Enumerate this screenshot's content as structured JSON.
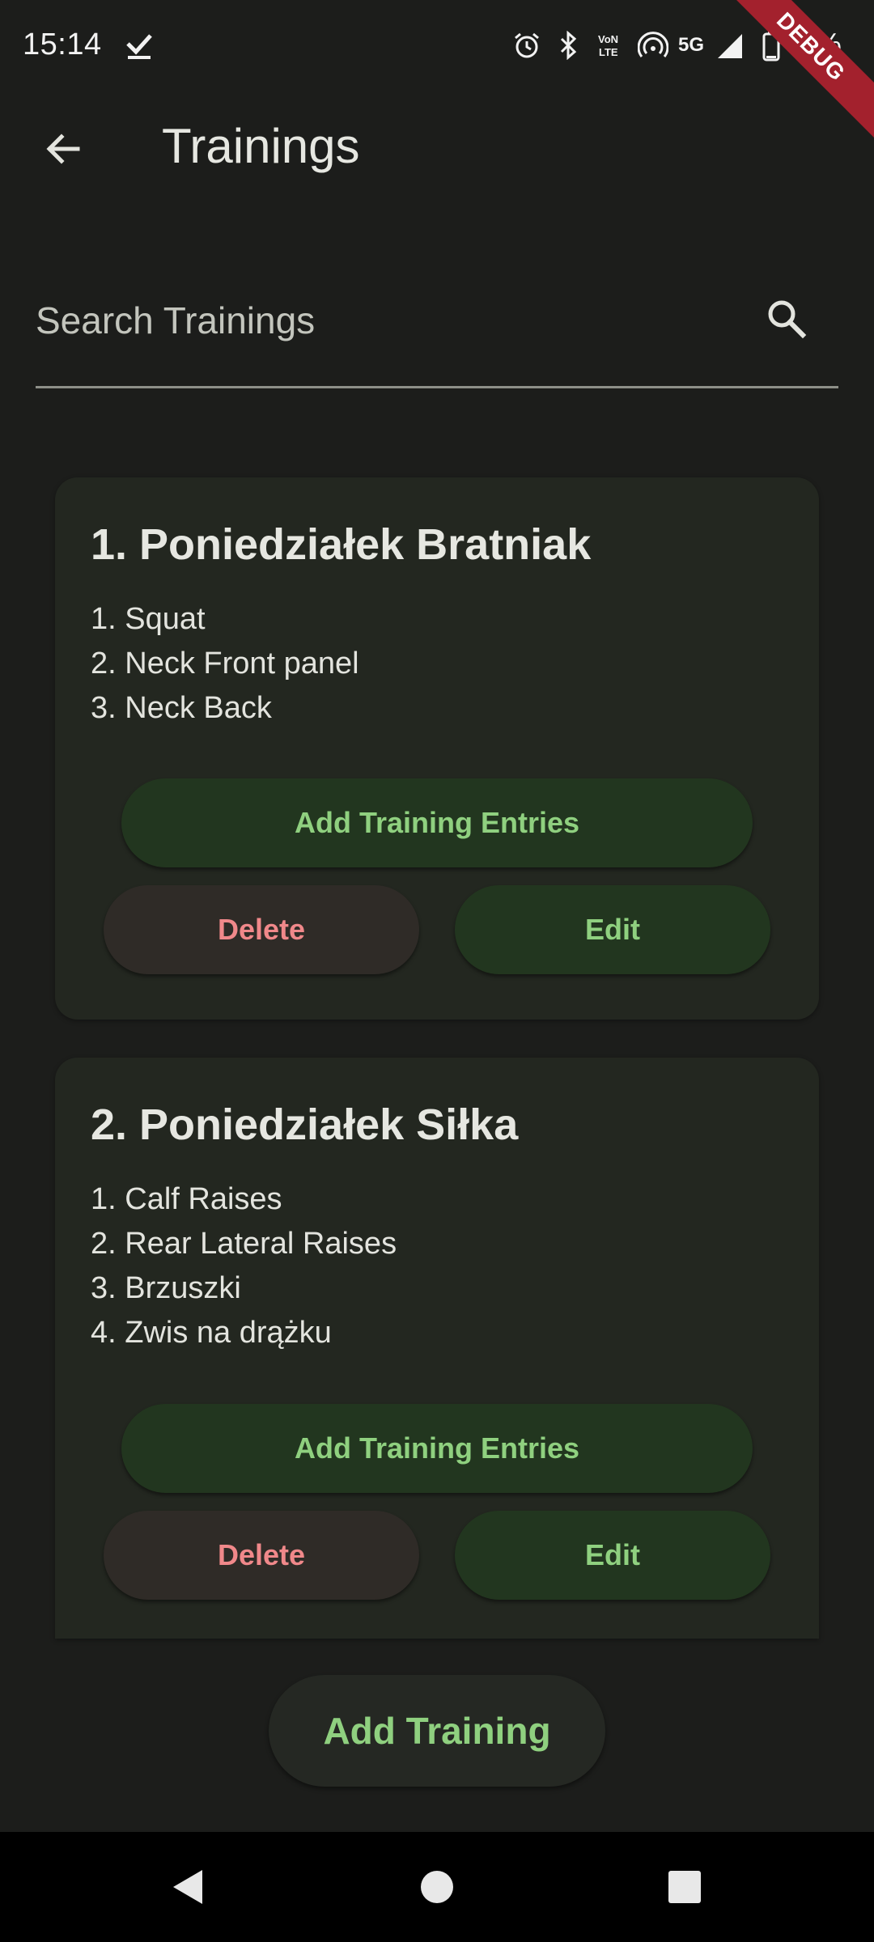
{
  "status_bar": {
    "time": "15:14",
    "network": "5G",
    "battery_text": "1%",
    "debug_banner": "DEBUG"
  },
  "app_bar": {
    "title": "Trainings"
  },
  "search": {
    "placeholder": "Search Trainings"
  },
  "trainings": [
    {
      "title": "1. Poniedziałek Bratniak",
      "exercises": [
        "1. Squat",
        "2. Neck Front panel",
        "3. Neck Back"
      ],
      "add_entries_label": "Add Training Entries",
      "delete_label": "Delete",
      "edit_label": "Edit"
    },
    {
      "title": "2. Poniedziałek Siłka",
      "exercises": [
        "1. Calf Raises",
        "2. Rear Lateral Raises",
        "3. Brzuszki",
        "4. Zwis na drążku"
      ],
      "add_entries_label": "Add Training Entries",
      "delete_label": "Delete",
      "edit_label": "Edit"
    }
  ],
  "add_training_label": "Add Training",
  "colors": {
    "background": "#1c1d1b",
    "card": "#232720",
    "accent_green": "#8fd07f",
    "accent_red": "#f0888a",
    "debug_ribbon": "#a3212d"
  },
  "icons": {
    "back": "arrow-back-icon",
    "search": "search-icon",
    "nav_back": "triangle-back-icon",
    "nav_home": "circle-home-icon",
    "nav_recents": "square-recents-icon"
  }
}
